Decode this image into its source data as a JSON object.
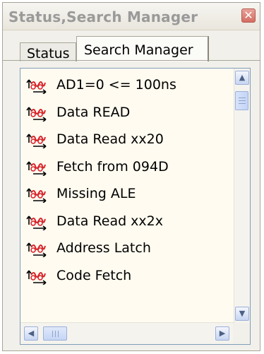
{
  "window": {
    "title": "Status,Search Manager",
    "close_glyph": "✕"
  },
  "tabs": [
    {
      "label": "Status",
      "active": false
    },
    {
      "label": "Search Manager",
      "active": true
    }
  ],
  "list": {
    "items": [
      {
        "label": "AD1=0 <= 100ns",
        "icon": "search-filter-icon"
      },
      {
        "label": "Data READ",
        "icon": "search-filter-icon"
      },
      {
        "label": "Data Read xx20",
        "icon": "search-filter-icon"
      },
      {
        "label": "Fetch from 094D",
        "icon": "search-filter-icon"
      },
      {
        "label": "Missing ALE",
        "icon": "search-filter-icon"
      },
      {
        "label": "Data Read xx2x",
        "icon": "search-filter-icon"
      },
      {
        "label": "Address Latch",
        "icon": "search-filter-icon"
      },
      {
        "label": "Code Fetch",
        "icon": "search-filter-icon"
      }
    ]
  },
  "scrollbar": {
    "up_glyph": "▲",
    "down_glyph": "▼",
    "left_glyph": "◀",
    "right_glyph": "▶"
  },
  "colors": {
    "list_background": "#fffbf0",
    "icon_red": "#d8242b",
    "scroll_accent": "#c7d5f2"
  }
}
